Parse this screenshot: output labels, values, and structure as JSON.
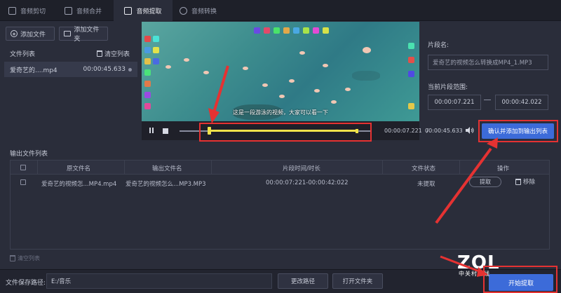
{
  "tabs": [
    {
      "label": "音频剪切",
      "icon": "scissors-icon",
      "active": false
    },
    {
      "label": "音频合并",
      "icon": "merge-icon",
      "active": false
    },
    {
      "label": "音频提取",
      "icon": "extract-icon",
      "active": true
    },
    {
      "label": "音频转换",
      "icon": "convert-icon",
      "active": false
    }
  ],
  "file_panel": {
    "add_file": "添加文件",
    "add_folder": "添加文件夹",
    "list_label": "文件列表",
    "clear_list": "清空列表",
    "files": [
      {
        "name": "爱奇艺的....mp4",
        "duration": "00:00:45.633"
      }
    ]
  },
  "video": {
    "subtitle": "这是一段游泳的视频，大家可以看一下"
  },
  "player": {
    "current_time": "00:00:07.221",
    "separator": "/",
    "total_time": "00:00:45.633",
    "selection_start_fraction": 0.158,
    "selection_end_fraction": 0.922
  },
  "segment": {
    "name_label": "片段名:",
    "name_value": "爱奇艺的视频怎么转换成MP4_1.MP3",
    "range_label": "当前片段范围:",
    "start": "00:00:07.221",
    "end": "00:00:42.022",
    "confirm_button": "确认并添加到输出列表"
  },
  "output": {
    "section_label": "输出文件列表",
    "columns": [
      "原文件名",
      "输出文件名",
      "片段时间/时长",
      "文件状态",
      "操作"
    ],
    "rows": [
      {
        "source": "爱奇艺的视频怎...MP4.mp4",
        "output": "爱奇艺的视频怎么...MP3.MP3",
        "time": "00:00:07:221-00:00:42:022",
        "status": "未提取",
        "extract": "提取",
        "remove": "移除"
      }
    ],
    "clear_list": "清空列表"
  },
  "bottom": {
    "save_path_label": "文件保存路径:",
    "save_path": "E:/音乐",
    "change_path": "更改路径",
    "open_folder": "打开文件夹",
    "start_button": "开始提取"
  },
  "watermark": {
    "logo": "ZOL",
    "tagline": "中关村在线"
  },
  "colors": {
    "accent": "#3c6bd9",
    "annotation": "#e53232",
    "selection": "#f0e24a"
  }
}
